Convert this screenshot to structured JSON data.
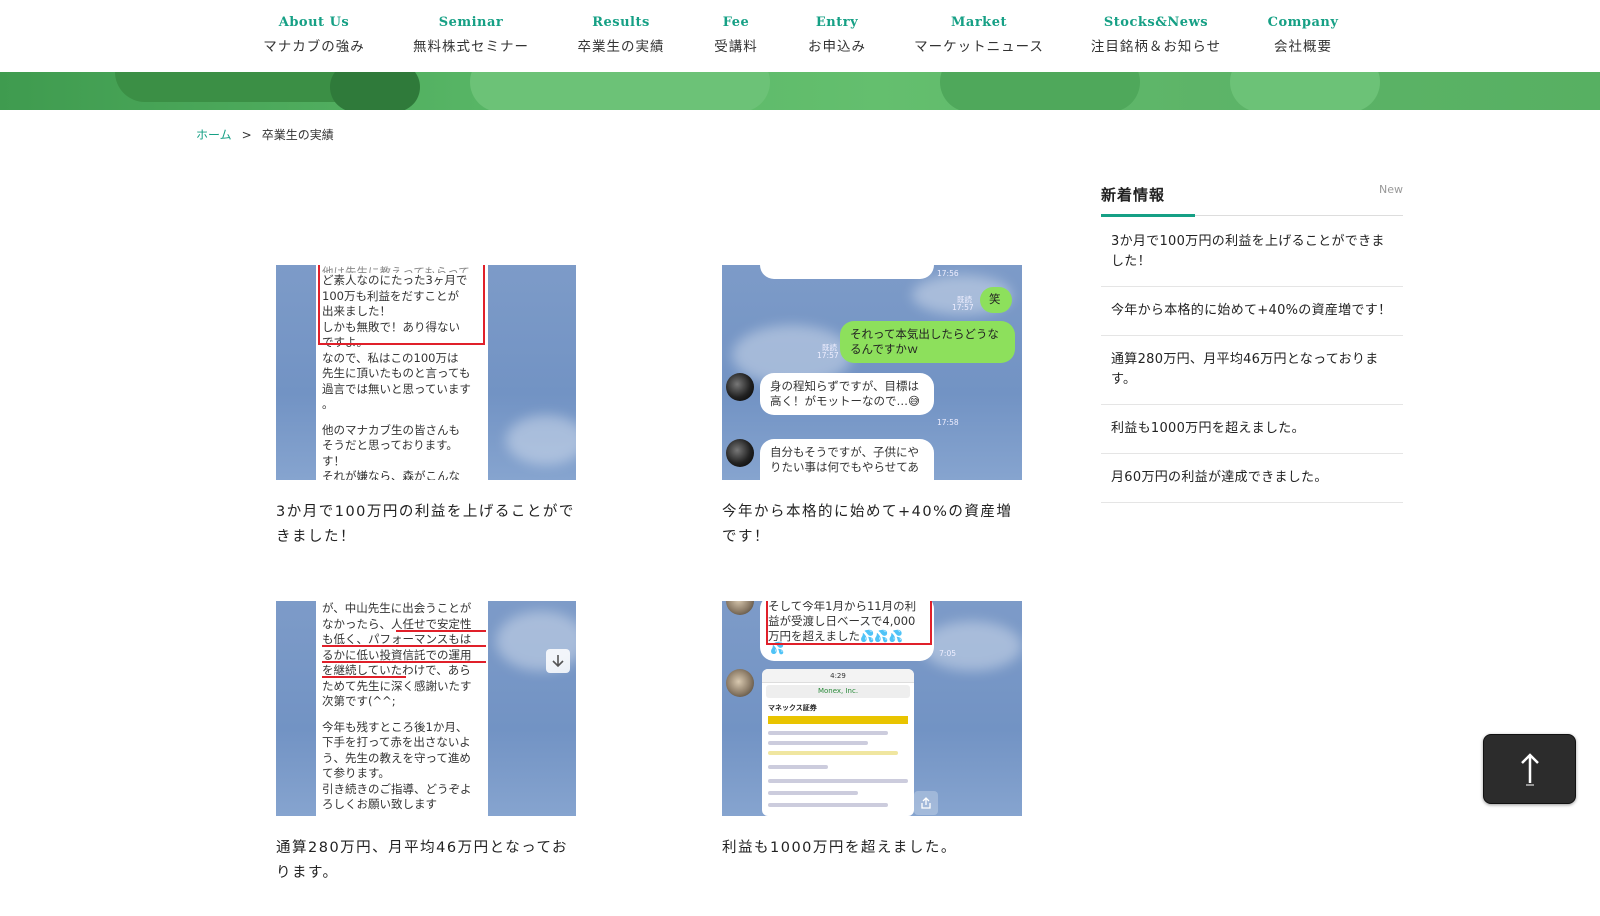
{
  "nav": {
    "items": [
      {
        "en": "About Us",
        "ja": "マナカブの強み"
      },
      {
        "en": "Seminar",
        "ja": "無料株式セミナー"
      },
      {
        "en": "Results",
        "ja": "卒業生の実績"
      },
      {
        "en": "Fee",
        "ja": "受講料"
      },
      {
        "en": "Entry",
        "ja": "お申込み"
      },
      {
        "en": "Market",
        "ja": "マーケットニュース"
      },
      {
        "en": "Stocks&News",
        "ja": "注目銘柄＆お知らせ"
      },
      {
        "en": "Company",
        "ja": "会社概要"
      }
    ]
  },
  "breadcrumb": {
    "home": "ホーム",
    "separator": ">",
    "current": "卒業生の実績"
  },
  "cards": [
    {
      "title": "3か月で100万円の利益を上げることができました！",
      "image_text": [
        "ど素人なのにたった3ヶ月で",
        "100万も利益をだすことが",
        "出来ました！",
        "しかも無敗で！あり得ない",
        "ですよ。",
        "なので、私はこの100万は",
        "先生に頂いたものと言っても",
        "過言では無いと思っています",
        "。",
        "",
        "他のマナカブ生の皆さんも",
        "そうだと思っております。",
        "す！",
        "それが嫌なら、森がこんな"
      ]
    },
    {
      "title": "今年から本格的に始めて+40%の資産増です！",
      "chat": {
        "ts1": "17:56",
        "sticker": "笑",
        "read1": "既読",
        "ts2": "17:57",
        "msg1": "それって本気出したらどうなるんですかｗ",
        "read2": "既読",
        "ts3": "17:57",
        "msg2": "身の程知らずですが、目標は高く！がモットーなので…😅",
        "ts4": "17:58",
        "msg3": "自分もそうですが、子供にやりたい事は何でもやらせてあ"
      }
    },
    {
      "title": "通算280万円、月平均46万円となっております。",
      "image_text": [
        "が、中山先生に出会うことが",
        "なかったら、人任せで安定性",
        "も低く、パフォーマンスもは",
        "るかに低い投資信託での運用",
        "を継続していたわけで、あら",
        "ためて先生に深く感謝いたす",
        "次第です(^^;",
        "",
        "今年も残すところ後1か月、",
        "下手を打って赤を出さないよ",
        "う、先生の教えを守って進め",
        "て参ります。",
        "引き続きのご指導、どうぞよ",
        "ろしくお願い致します"
      ]
    },
    {
      "title": "利益も1000万円を超えました。",
      "chat": {
        "line1": "そして今年1月から11月の利",
        "line2": "益が受渡し日ベースで4,000",
        "line3": "万円を超えました💦💦💦",
        "line4": "💦",
        "ts": "7:05",
        "phone_url": "Monex, Inc.",
        "phone_time": "4:29",
        "phone_brand": "マネックス証券"
      }
    }
  ],
  "sidebar": {
    "title": "新着情報",
    "sub": "New",
    "items": [
      "3か月で100万円の利益を上げることができました！",
      "今年から本格的に始めて+40%の資産増です！",
      "通算280万円、月平均46万円となっております。",
      "利益も1000万円を超えました。",
      "月60万円の利益が達成できました。"
    ]
  },
  "icons": {
    "totop": "arrow-up-icon",
    "scroll_down": "arrow-down-icon",
    "share": "share-icon"
  },
  "colors": {
    "accent": "#16a085",
    "banner_green": "#5db468",
    "highlight_red": "#e0202a",
    "line_green_bubble": "#8de05c",
    "chat_bg": "#7293c4",
    "totop_bg": "#2c2c2c"
  }
}
